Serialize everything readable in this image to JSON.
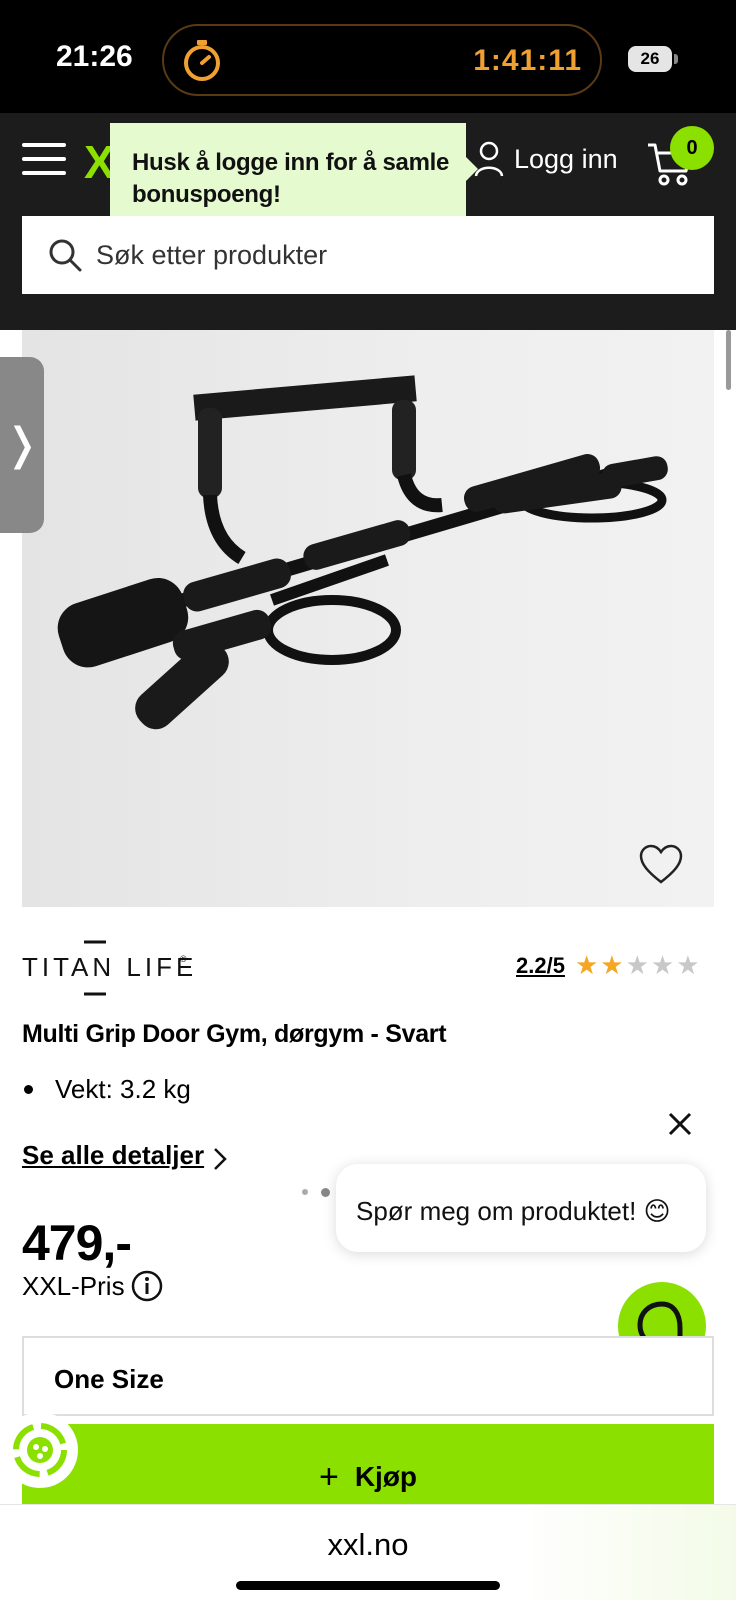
{
  "status_bar": {
    "time": "21:26",
    "timer": "1:41:11",
    "battery": "26"
  },
  "header": {
    "logo": "X",
    "login_tooltip": "Husk å logge inn for å samle bonuspoeng!",
    "login_label": "Logg inn",
    "cart_count": "0",
    "search_placeholder": "Søk etter produkter"
  },
  "gallery": {
    "side_tab_glyph": "❭",
    "image_count": 7,
    "active_index": 3
  },
  "product": {
    "brand": "TITAN LIFE",
    "rating_text": "2.2/5",
    "rating_value": 2.2,
    "rating_max": 5,
    "title": "Multi Grip Door Gym, dørgym - Svart",
    "specs": [
      "Vekt: 3.2 kg"
    ],
    "details_link": "Se alle detaljer",
    "price": "479,-",
    "price_label": "XXL-Pris",
    "size": "One Size",
    "buy_label": "Kjøp"
  },
  "chat": {
    "bubble_text": "Spør meg om produktet! 😊"
  },
  "browser": {
    "url": "xxl.no"
  },
  "colors": {
    "accent": "#8ce000",
    "header_bg": "#1c1c1c",
    "timer": "#f0a030",
    "star_filled": "#f5a623",
    "star_empty": "#c8c8c8"
  }
}
